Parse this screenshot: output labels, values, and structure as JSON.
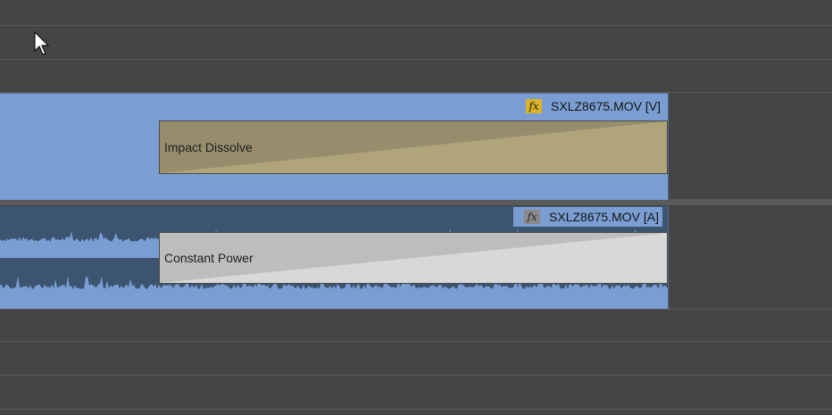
{
  "timeline": {
    "video_clip": {
      "name": "SXLZ8675.MOV [V]",
      "fx_label": "fx",
      "color": "#7a9ed2",
      "transition": {
        "label": "Impact Dissolve",
        "color_light": "#b0a47a",
        "color_dark": "#978d6d"
      }
    },
    "audio_clip": {
      "name": "SXLZ8675.MOV [A]",
      "fx_label": "fx",
      "color": "#3c546f",
      "waveform_color": "#7a9ed2",
      "transition": {
        "label": "Constant Power",
        "color_light": "#d8d8d8",
        "color_dark": "#bdbdbd"
      }
    }
  },
  "icons": {
    "cursor": "mouse-pointer-icon",
    "fx_video": "fx-badge-icon",
    "fx_audio": "fx-badge-icon"
  }
}
